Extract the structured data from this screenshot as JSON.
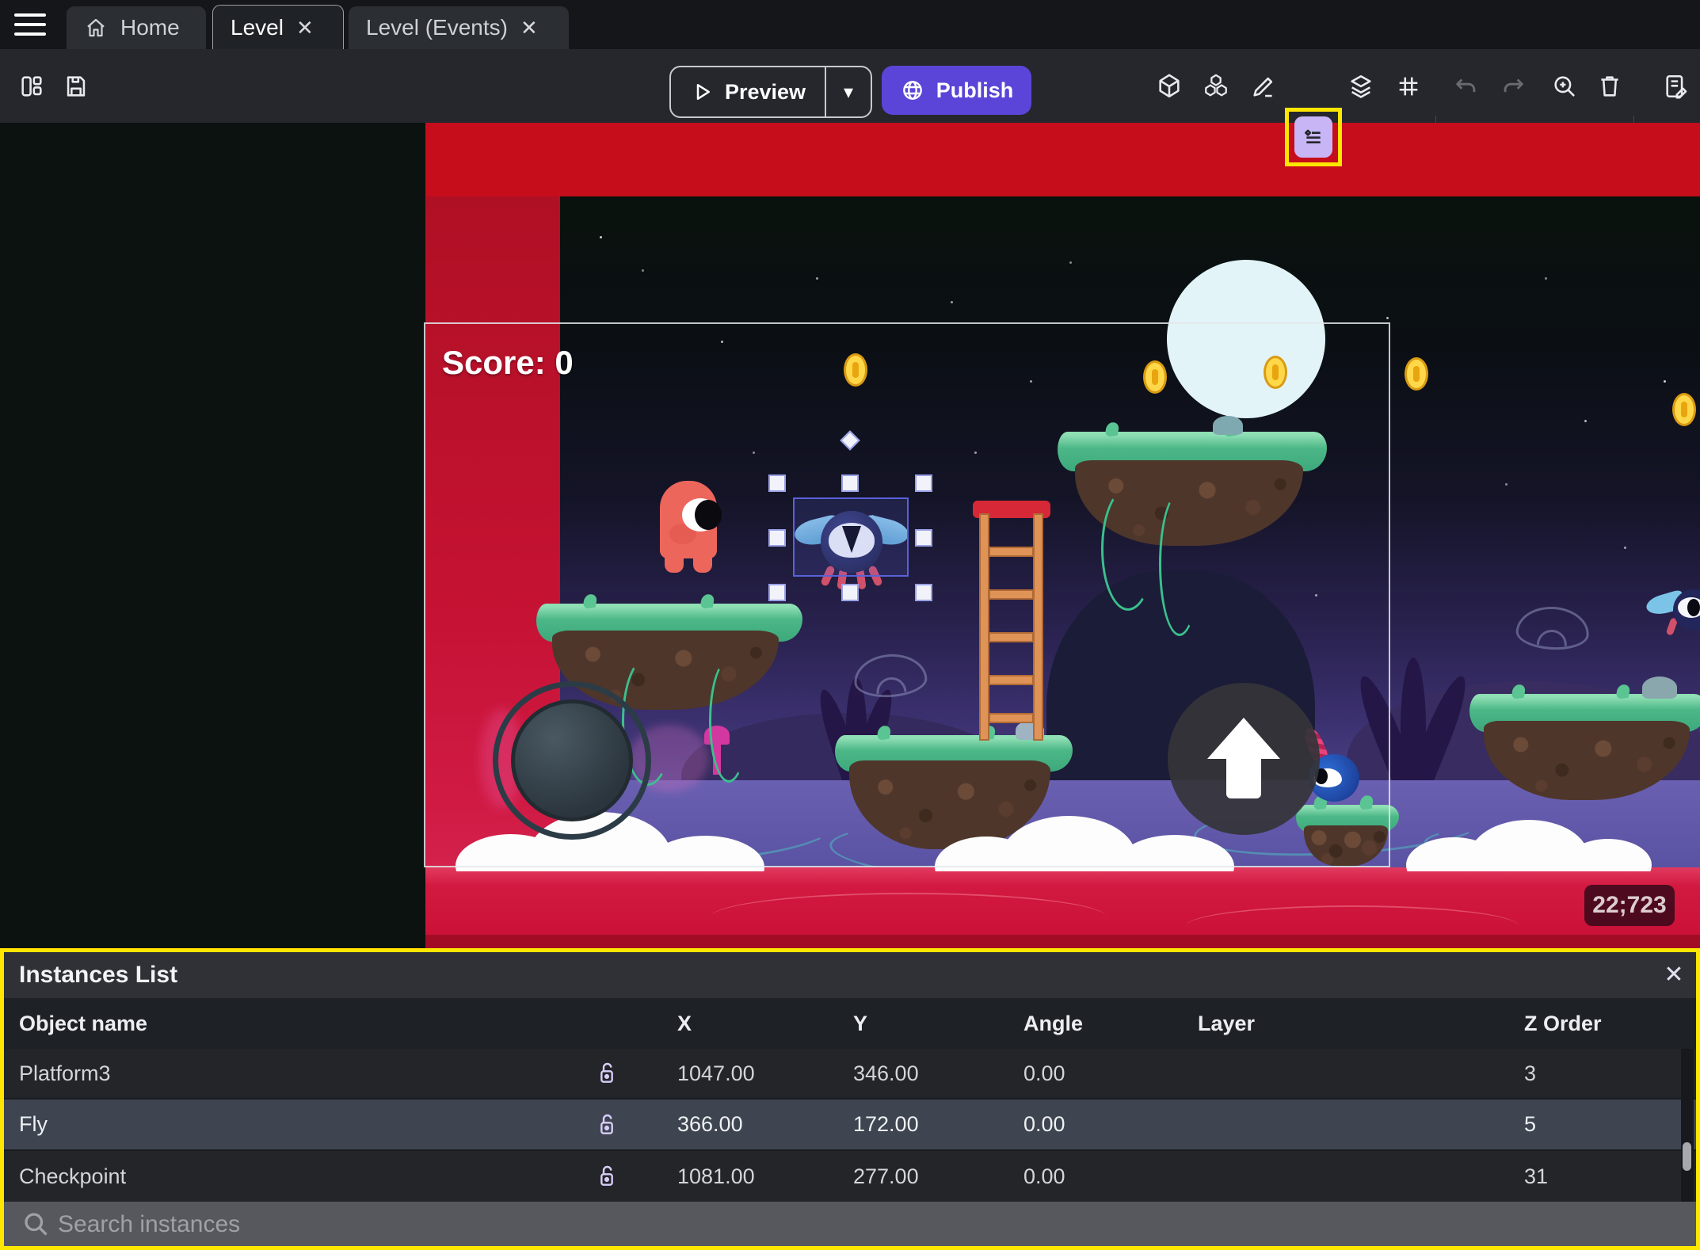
{
  "icons": {
    "close": "✕",
    "dropdown": "▾"
  },
  "tabs": {
    "home": "Home",
    "level": "Level",
    "events": "Level (Events)"
  },
  "toolbar": {
    "preview": "Preview",
    "publish": "Publish"
  },
  "canvas": {
    "score": "Score: 0",
    "coords": "22;723"
  },
  "panel": {
    "title": "Instances List",
    "columns": {
      "name": "Object name",
      "x": "X",
      "y": "Y",
      "angle": "Angle",
      "layer": "Layer",
      "z": "Z Order"
    },
    "rows": [
      {
        "name": "Platform3",
        "x": "1047.00",
        "y": "346.00",
        "angle": "0.00",
        "layer": "",
        "z": "3"
      },
      {
        "name": "Fly",
        "x": "366.00",
        "y": "172.00",
        "angle": "0.00",
        "layer": "",
        "z": "5"
      },
      {
        "name": "Checkpoint",
        "x": "1081.00",
        "y": "277.00",
        "angle": "0.00",
        "layer": "",
        "z": "31"
      }
    ],
    "search_placeholder": "Search instances"
  },
  "colors": {
    "accent": "#5b45d8",
    "highlight": "#ffe600",
    "selection": "#5a62d8",
    "selected_row": "#3e4450"
  }
}
